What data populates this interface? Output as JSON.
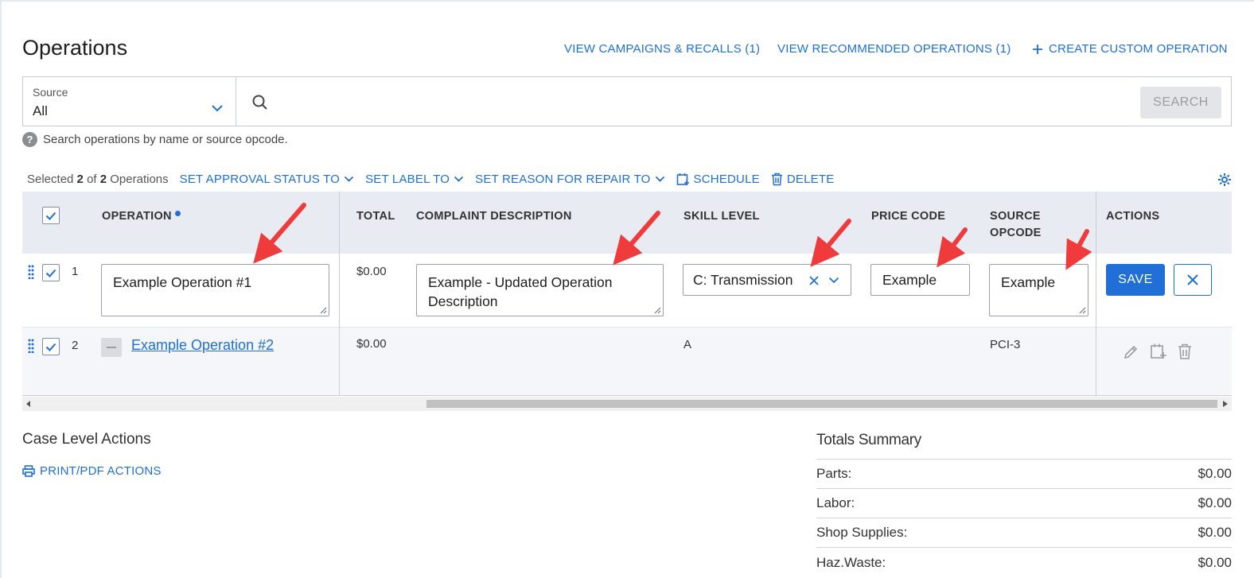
{
  "page": {
    "title": "Operations",
    "links": {
      "campaigns": "VIEW CAMPAIGNS & RECALLS (1)",
      "recommended": "VIEW RECOMMENDED OPERATIONS (1)",
      "create": "CREATE CUSTOM OPERATION"
    }
  },
  "search": {
    "source_label": "Source",
    "source_value": "All",
    "placeholder": "",
    "button_label": "SEARCH",
    "hint": "Search operations by name or source opcode."
  },
  "bulk": {
    "selected_prefix": "Selected",
    "selected_count": "2",
    "of_text": "of",
    "total_count": "2",
    "suffix": "Operations",
    "actions": {
      "approval": "SET APPROVAL STATUS TO",
      "label": "SET LABEL TO",
      "reason": "SET REASON FOR REPAIR TO",
      "schedule": "SCHEDULE",
      "delete": "DELETE"
    }
  },
  "table": {
    "headers": {
      "operation": "OPERATION",
      "total": "TOTAL",
      "complaint": "COMPLAINT DESCRIPTION",
      "skill": "SKILL LEVEL",
      "price": "PRICE CODE",
      "source_opcode_1": "SOURCE",
      "source_opcode_2": "OPCODE",
      "actions": "ACTIONS"
    },
    "rows": [
      {
        "num": "1",
        "operation": "Example Operation #1",
        "total": "$0.00",
        "complaint": "Example - Updated Operation Description",
        "skill": "C: Transmission",
        "price": "Example",
        "opcode": "Example",
        "save_label": "SAVE"
      },
      {
        "num": "2",
        "operation": "Example Operation #2",
        "total": "$0.00",
        "complaint": "",
        "skill": "A",
        "price": "",
        "opcode": "PCI-3"
      }
    ]
  },
  "case_actions": {
    "title": "Case Level Actions",
    "print_label": "PRINT/PDF ACTIONS"
  },
  "totals": {
    "title": "Totals Summary",
    "rows": [
      {
        "label": "Parts:",
        "value": "$0.00"
      },
      {
        "label": "Labor:",
        "value": "$0.00"
      },
      {
        "label": "Shop Supplies:",
        "value": "$0.00"
      },
      {
        "label": "Haz.Waste:",
        "value": "$0.00"
      }
    ]
  },
  "colors": {
    "accent": "#1f6fd6",
    "annotation_arrow": "#ef3b3b",
    "header_bg": "#e8ebf2"
  }
}
